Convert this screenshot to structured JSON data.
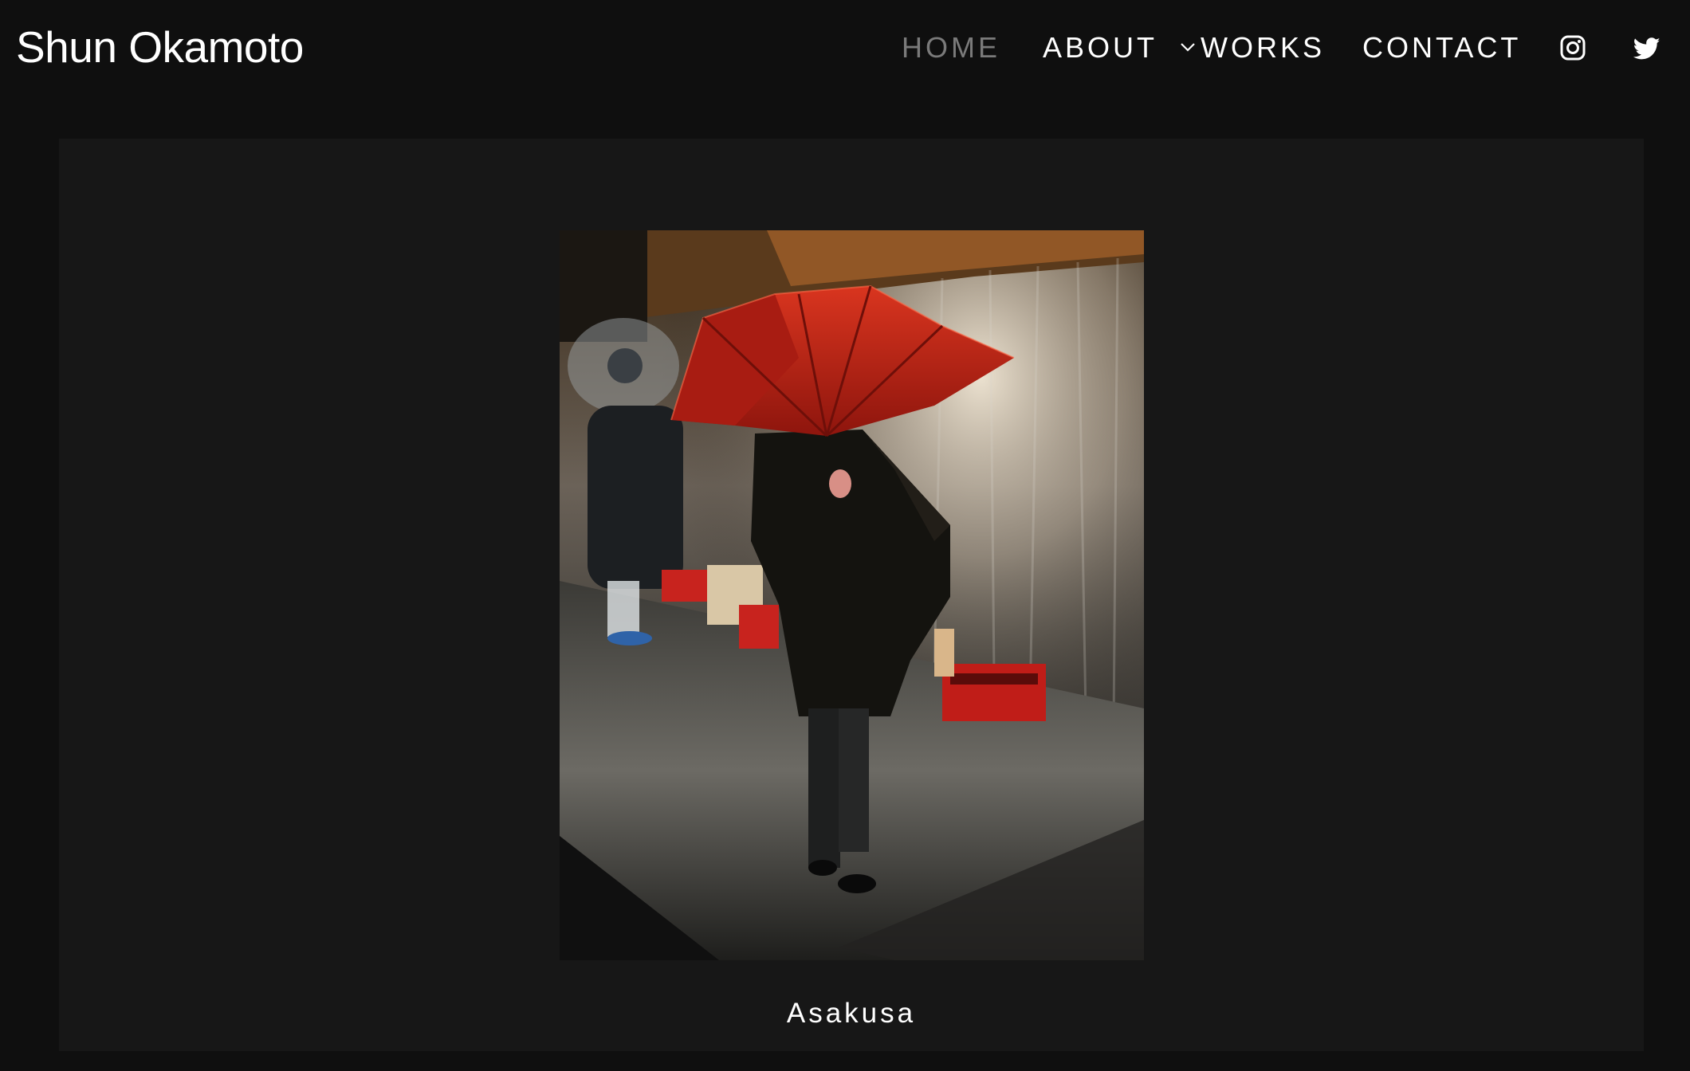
{
  "header": {
    "site_title": "Shun Okamoto"
  },
  "nav": {
    "items": [
      {
        "label": "HOME",
        "active": true
      },
      {
        "label": "ABOUT",
        "active": false
      },
      {
        "label": "WORKS",
        "active": false,
        "has_dropdown": true
      },
      {
        "label": "CONTACT",
        "active": false
      }
    ],
    "social": [
      {
        "icon": "instagram-icon"
      },
      {
        "icon": "twitter-icon"
      }
    ]
  },
  "gallery": {
    "caption": "Asakusa"
  },
  "colors": {
    "background": "#0f0f0f",
    "panel": "#171717",
    "nav_active": "#7a7a7a",
    "text": "#ffffff",
    "umbrella_red": "#c42519"
  }
}
